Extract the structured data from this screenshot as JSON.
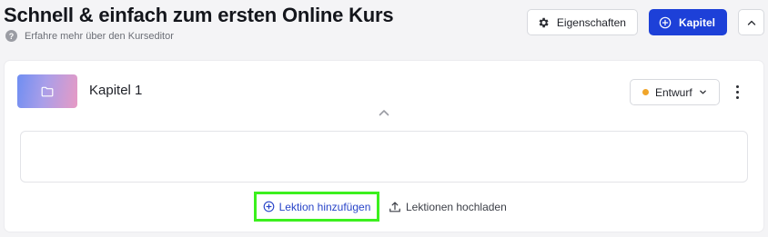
{
  "header": {
    "title": "Schnell & einfach zum ersten Online Kurs",
    "help_icon_glyph": "?",
    "help_link": "Erfahre mehr über den Kurseditor",
    "properties_button": "Eigenschaften",
    "chapter_button": "Kapitel"
  },
  "chapter": {
    "title": "Kapitel 1",
    "status": "Entwurf",
    "status_color": "#f0a52a",
    "thumbnail_icon": "folder-icon"
  },
  "actions": {
    "add_lesson": "Lektion hinzufügen",
    "upload_lessons": "Lektionen hochladen"
  },
  "colors": {
    "primary": "#1d40d8",
    "highlight": "#3cf01e",
    "link": "#2844c8"
  }
}
